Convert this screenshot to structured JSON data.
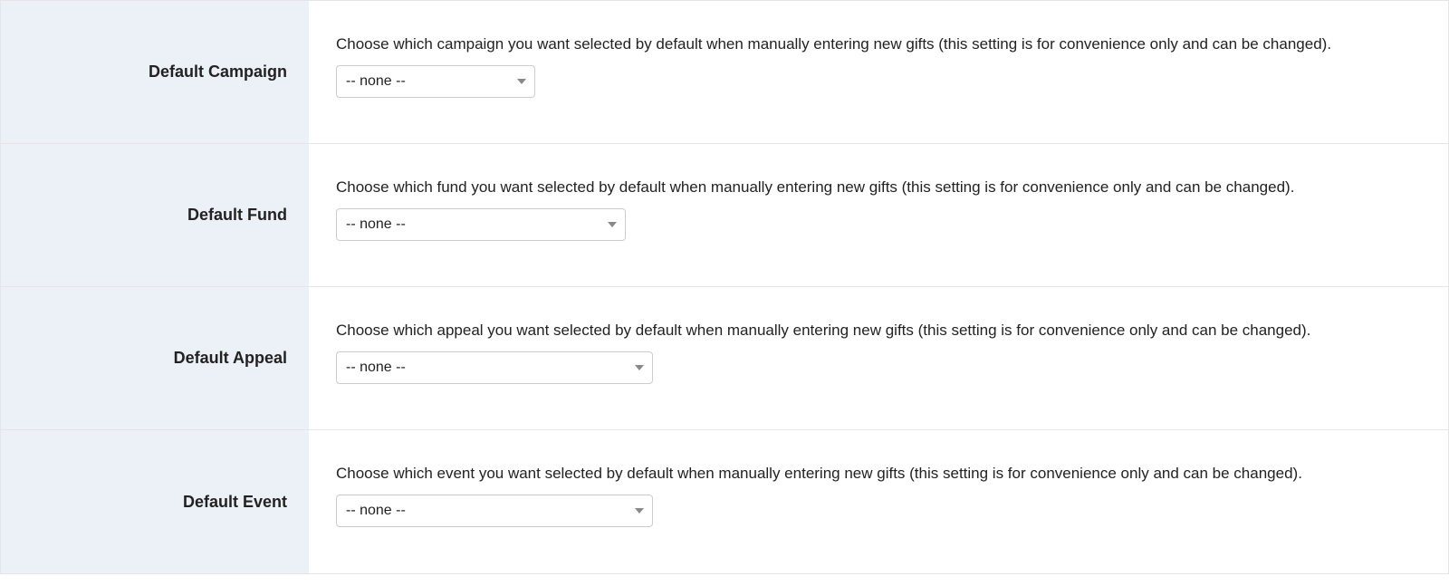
{
  "settings": [
    {
      "label": "Default Campaign",
      "description": "Choose which campaign you want selected by default when manually entering new gifts (this setting is for convenience only and can be changed).",
      "selected": "-- none --",
      "selectWidth": "w-220"
    },
    {
      "label": "Default Fund",
      "description": "Choose which fund you want selected by default when manually entering new gifts (this setting is for convenience only and can be changed).",
      "selected": "-- none --",
      "selectWidth": "w-320"
    },
    {
      "label": "Default Appeal",
      "description": "Choose which appeal you want selected by default when manually entering new gifts (this setting is for convenience only and can be changed).",
      "selected": "-- none --",
      "selectWidth": "w-350"
    },
    {
      "label": "Default Event",
      "description": "Choose which event you want selected by default when manually entering new gifts (this setting is for convenience only and can be changed).",
      "selected": "-- none --",
      "selectWidth": "w-350"
    }
  ]
}
